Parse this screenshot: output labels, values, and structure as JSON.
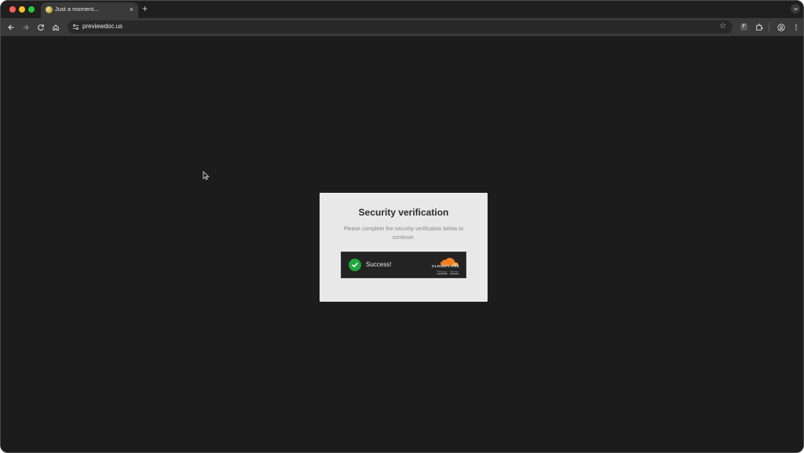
{
  "browser": {
    "tab": {
      "title": "Just a moment...",
      "close_glyph": "×",
      "favicon": "cloudflare-challenge-favicon"
    },
    "new_tab_glyph": "+",
    "address_bar": {
      "url": "previewdoc.us"
    },
    "toolbar_icons": [
      "back-icon",
      "forward-icon",
      "reload-icon",
      "home-icon",
      "site-info-icon",
      "bookmark-star-icon",
      "extension-f-icon",
      "extensions-puzzle-icon",
      "profile-icon",
      "menu-kebab-icon"
    ],
    "extension_letter": "F"
  },
  "verification": {
    "title": "Security verification",
    "description": "Please complete the security verification below to continue.",
    "widget": {
      "status": "Success!",
      "brand": "CLOUDFLARE",
      "privacy_link": "Privacy",
      "separator": "·",
      "terms_link": "Terms"
    }
  },
  "colors": {
    "page_background": "#1c1c1c",
    "card_background": "#e8e8e8",
    "success_green": "#1fa83c",
    "cloudflare_orange": "#f38020"
  }
}
